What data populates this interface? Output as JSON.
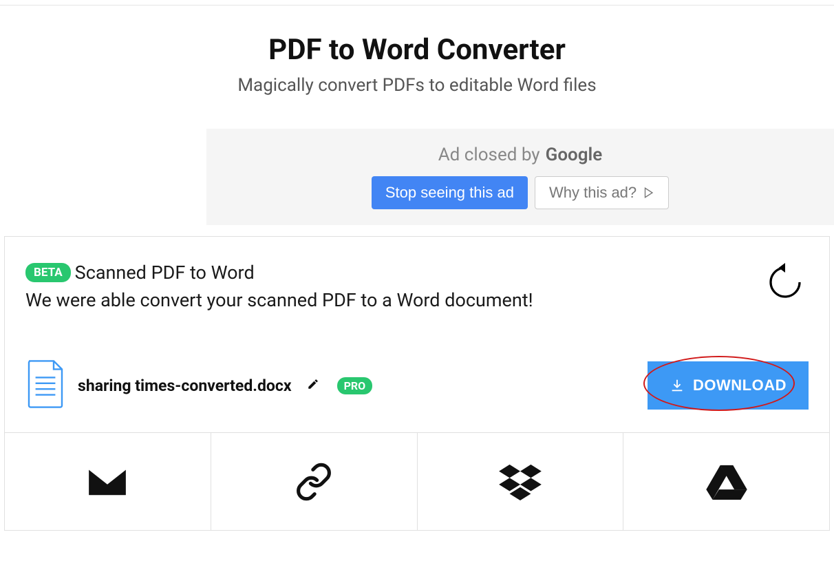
{
  "header": {
    "title": "PDF to Word Converter",
    "subtitle": "Magically convert PDFs to editable Word files"
  },
  "ad": {
    "closed_text": "Ad closed by",
    "brand": "Google",
    "stop_label": "Stop seeing this ad",
    "why_label": "Why this ad?"
  },
  "result": {
    "beta_badge": "BETA",
    "heading": "Scanned PDF to Word",
    "success_message": "We were able convert your scanned PDF to a Word document!",
    "filename": "sharing times-converted.docx",
    "pro_badge": "PRO",
    "download_label": "DOWNLOAD"
  },
  "colors": {
    "primary_blue": "#3d99f5",
    "ad_blue": "#4285f4",
    "badge_green": "#29c76f",
    "highlight_red": "#d11a1a"
  }
}
